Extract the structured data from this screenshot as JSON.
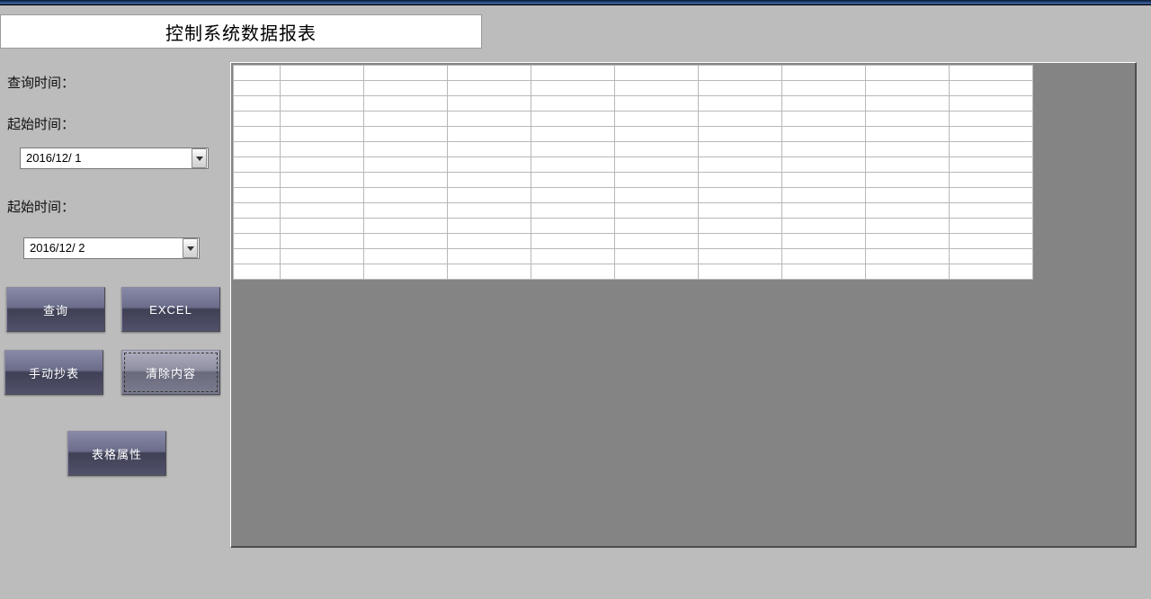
{
  "title": "控制系统数据报表",
  "labels": {
    "query_time": "查询时间：",
    "start_time_1": "起始时间：",
    "start_time_2": "起始时间："
  },
  "dates": {
    "from": "2016/12/ 1",
    "to": "2016/12/ 2"
  },
  "buttons": {
    "query": "查询",
    "excel": "EXCEL",
    "manual": "手动抄表",
    "clear": "清除内容",
    "props": "表格属性"
  },
  "grid": {
    "rows": 14,
    "cols": 10,
    "first_col_width": 52,
    "other_col_width": 93
  }
}
